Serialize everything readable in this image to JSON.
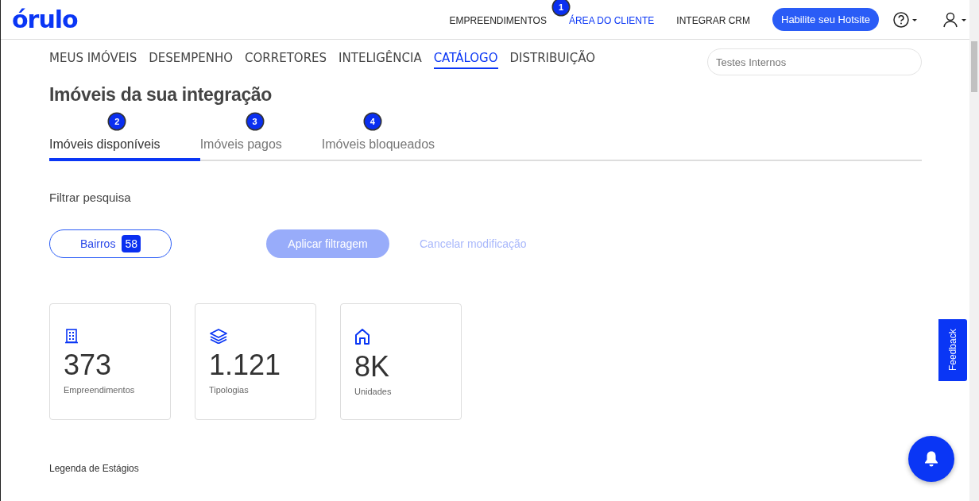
{
  "header": {
    "logo": "órulo",
    "nav": [
      {
        "label": "EMPREENDIMENTOS",
        "selected": false
      },
      {
        "label": "ÁREA DO CLIENTE",
        "selected": true,
        "marker": "1"
      },
      {
        "label": "INTEGRAR CRM",
        "selected": false
      }
    ],
    "cta": "Habilite seu Hotsite"
  },
  "section_nav": {
    "items": [
      {
        "label": "MEUS IMÓVEIS",
        "selected": false
      },
      {
        "label": "DESEMPENHO",
        "selected": false
      },
      {
        "label": "CORRETORES",
        "selected": false
      },
      {
        "label": "INTELIGÊNCIA",
        "selected": false
      },
      {
        "label": "CATÁLOGO",
        "selected": true
      },
      {
        "label": "DISTRIBUIÇÃO",
        "selected": false
      }
    ],
    "search": {
      "placeholder": "Testes Internos"
    }
  },
  "page_title": "Imóveis da sua integração",
  "tabs": [
    {
      "label": "Imóveis disponíveis",
      "selected": true,
      "marker": "2"
    },
    {
      "label": "Imóveis pagos",
      "selected": false,
      "marker": "3"
    },
    {
      "label": "Imóveis bloqueados",
      "selected": false,
      "marker": "4"
    }
  ],
  "filter": {
    "label": "Filtrar pesquisa",
    "chip": {
      "label": "Bairros",
      "count": "58"
    },
    "apply": {
      "label": "Aplicar filtragem",
      "disabled": true
    },
    "cancel": {
      "label": "Cancelar modificação",
      "disabled": true
    }
  },
  "stats": [
    {
      "kind": "building",
      "value": "373",
      "label": "Empreendimentos"
    },
    {
      "kind": "layers",
      "value": "1.121",
      "label": "Tipologias"
    },
    {
      "kind": "house",
      "value": "8K",
      "label": "Unidades"
    }
  ],
  "legend": {
    "title": "Legenda de Estágios"
  },
  "feedback": "Feedback"
}
